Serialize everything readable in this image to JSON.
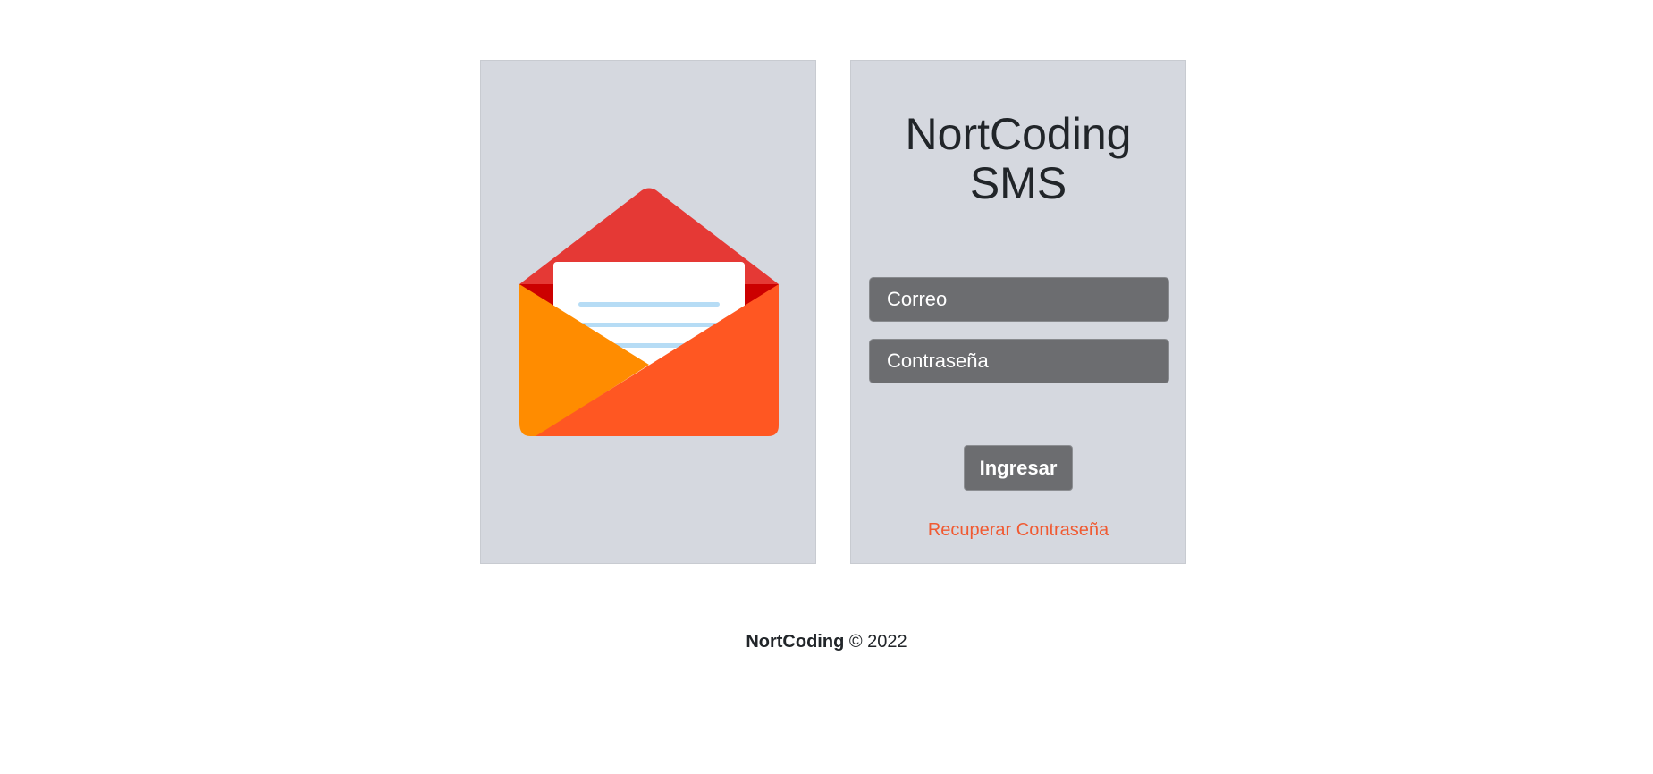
{
  "left_panel": {
    "illustration_icon": "open-envelope-icon",
    "colors": {
      "flap": "#e53935",
      "inner": "#cc0000",
      "letter": "#ffffff",
      "letter_lines": "#b6dcf5",
      "left_fold": "#ff8c00",
      "front": "#ff5722"
    }
  },
  "login": {
    "title_line1": "NortCoding",
    "title_line2": "SMS",
    "email_placeholder": "Correo",
    "email_value": "",
    "password_placeholder": "Contraseña",
    "password_value": "",
    "submit_label": "Ingresar",
    "recover_link": "Recuperar Contraseña"
  },
  "footer": {
    "brand": "NortCoding",
    "copyright": "© 2022"
  },
  "colors": {
    "panel_bg": "#d5d8df",
    "input_bg": "#6c6d70",
    "link": "#f05a32",
    "text": "#212529"
  }
}
